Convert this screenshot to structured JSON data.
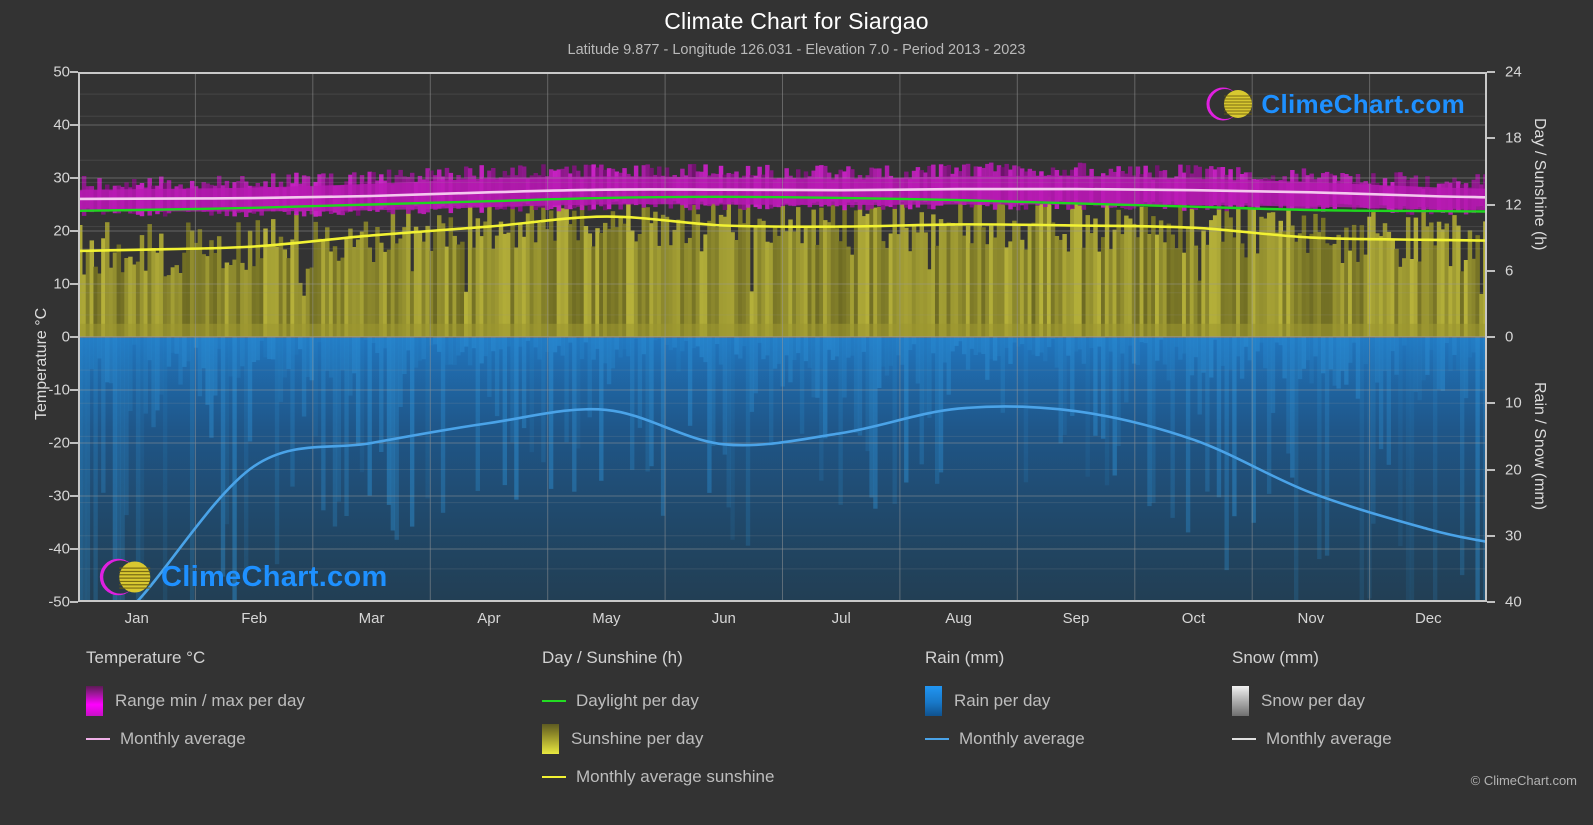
{
  "header": {
    "title": "Climate Chart for Siargao",
    "subtitle": "Latitude 9.877 - Longitude 126.031 - Elevation 7.0 - Period 2013 - 2023"
  },
  "watermark": {
    "text": "ClimeChart.com"
  },
  "footer": {
    "copyright": "© ClimeChart.com"
  },
  "axes": {
    "left_title": "Temperature °C",
    "right_title_top": "Day / Sunshine (h)",
    "right_title_bottom": "Rain / Snow (mm)",
    "left_ticks": [
      "50",
      "40",
      "30",
      "20",
      "10",
      "0",
      "-10",
      "-20",
      "-30",
      "-40",
      "-50"
    ],
    "right_ticks_top": [
      "24",
      "18",
      "12",
      "6",
      "0"
    ],
    "right_ticks_bottom": [
      "10",
      "20",
      "30",
      "40"
    ],
    "x_ticks": [
      "Jan",
      "Feb",
      "Mar",
      "Apr",
      "May",
      "Jun",
      "Jul",
      "Aug",
      "Sep",
      "Oct",
      "Nov",
      "Dec"
    ]
  },
  "legend": {
    "temperature": {
      "heading": "Temperature °C",
      "items": [
        {
          "label": "Range min / max per day",
          "marker": "band",
          "color": "#ff00ff"
        },
        {
          "label": "Monthly average",
          "marker": "line",
          "color": "#f0b0e8"
        }
      ]
    },
    "daylight": {
      "heading": "Day / Sunshine (h)",
      "items": [
        {
          "label": "Daylight per day",
          "marker": "line",
          "color": "#22dd22"
        },
        {
          "label": "Sunshine per day",
          "marker": "band",
          "color": "#d8d840"
        },
        {
          "label": "Monthly average sunshine",
          "marker": "line",
          "color": "#f2f233"
        }
      ]
    },
    "rain": {
      "heading": "Rain (mm)",
      "items": [
        {
          "label": "Rain per day",
          "marker": "band",
          "color": "#1e90ff"
        },
        {
          "label": "Monthly average",
          "marker": "line",
          "color": "#4aa3e8"
        }
      ]
    },
    "snow": {
      "heading": "Snow (mm)",
      "items": [
        {
          "label": "Snow per day",
          "marker": "band",
          "color": "#dddddd"
        },
        {
          "label": "Monthly average",
          "marker": "line",
          "color": "#e0e0e0"
        }
      ]
    }
  },
  "chart_data": {
    "type": "line",
    "title": "Climate Chart for Siargao",
    "subtitle": "Latitude 9.877 - Longitude 126.031 - Elevation 7.0 - Period 2013 - 2023",
    "xlabel": "",
    "ylabel": "Temperature °C",
    "ylabel_right_top": "Day / Sunshine (h)",
    "ylabel_right_bottom": "Rain / Snow (mm)",
    "ylim": [
      -50,
      50
    ],
    "ylim_right_day": [
      0,
      24
    ],
    "ylim_right_rain": [
      0,
      40
    ],
    "grid": true,
    "legend_position": "below",
    "categories": [
      "Jan",
      "Feb",
      "Mar",
      "Apr",
      "May",
      "Jun",
      "Jul",
      "Aug",
      "Sep",
      "Oct",
      "Nov",
      "Dec"
    ],
    "series": [
      {
        "name": "Monthly average temperature",
        "unit": "°C",
        "axis": "left",
        "color": "#f0b0e8",
        "values": [
          26.1,
          26.2,
          26.6,
          27.3,
          27.8,
          27.8,
          27.7,
          27.9,
          27.9,
          27.7,
          27.3,
          26.6
        ]
      },
      {
        "name": "Range min / max per day",
        "unit": "°C",
        "axis": "left",
        "color": "#ff00ff",
        "min_values": [
          23.5,
          23.5,
          23.7,
          24.3,
          24.8,
          24.8,
          24.7,
          24.8,
          24.8,
          24.7,
          24.4,
          23.9
        ],
        "max_values": [
          29.0,
          29.3,
          30.0,
          31.0,
          31.4,
          31.2,
          31.0,
          31.4,
          31.5,
          31.0,
          30.3,
          29.4
        ]
      },
      {
        "name": "Daylight per day",
        "unit": "h",
        "axis": "right_day",
        "color": "#22dd22",
        "values": [
          11.5,
          11.7,
          12.0,
          12.3,
          12.6,
          12.7,
          12.6,
          12.4,
          12.1,
          11.8,
          11.5,
          11.4
        ]
      },
      {
        "name": "Monthly average sunshine",
        "unit": "h",
        "axis": "right_day",
        "color": "#f2f233",
        "values": [
          7.9,
          8.2,
          9.2,
          10.0,
          10.9,
          10.1,
          10.0,
          10.2,
          10.1,
          9.9,
          9.0,
          8.8
        ]
      },
      {
        "name": "Monthly average rain",
        "unit": "mm",
        "axis": "right_rain",
        "color": "#4aa3e8",
        "values": [
          40.0,
          19.5,
          16.0,
          13.0,
          11.0,
          16.2,
          14.5,
          10.8,
          11.2,
          15.5,
          23.5,
          29.0
        ]
      }
    ]
  }
}
